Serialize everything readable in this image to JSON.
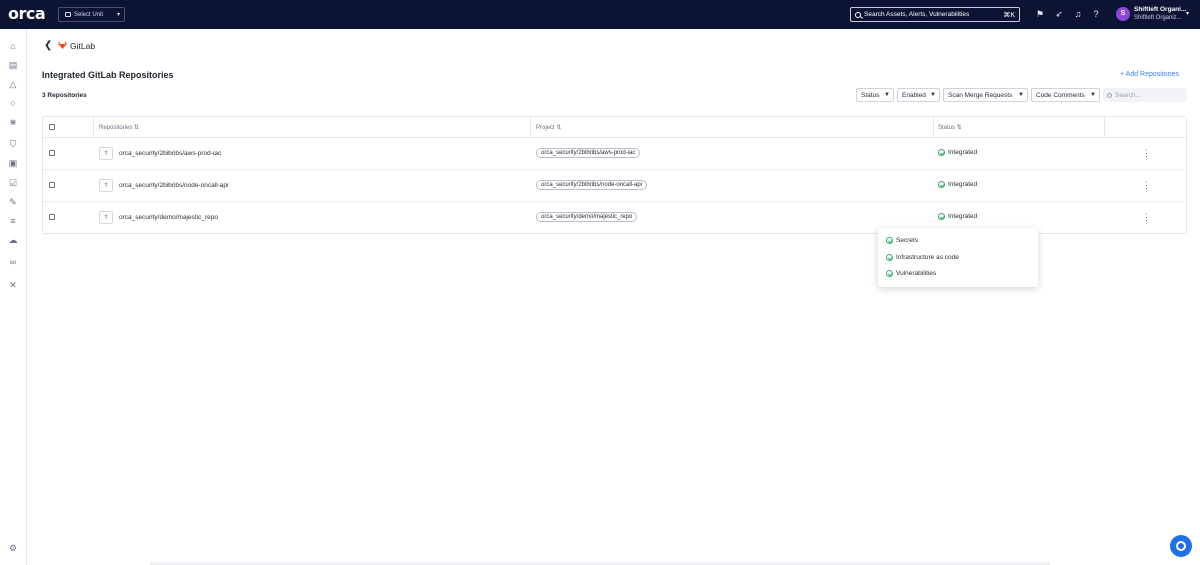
{
  "topbar": {
    "logo": "orca",
    "unit_select": "Select Unit",
    "search_placeholder": "Search Assets, Alerts, Vulnerabilities",
    "search_shortcut": "⌘K",
    "org_name": "Shiftleft Organi...",
    "org_sub": "Shiftleft Organiz...",
    "avatar_initial": "S"
  },
  "breadcrumb": {
    "title": "GitLab"
  },
  "section": {
    "title": "Integrated GitLab Repositories",
    "add_label": "+ Add Repositories",
    "count_label": "3 Repositories"
  },
  "filters": {
    "status": "Status",
    "enabled": "Enabled",
    "scan_merge": "Scan Merge Requests",
    "code_comments": "Code Comments",
    "search_placeholder": "Search..."
  },
  "table": {
    "headers": {
      "repositories": "Repositories ⇅",
      "project": "Project ⇅",
      "status": "Status ⇅"
    },
    "rows": [
      {
        "repo": "orca_security/2bibribs/aws-prod-iac",
        "project": "orca_security/2bibribs/aws-prod-iac",
        "status": "Integrated"
      },
      {
        "repo": "orca_security/2bibribs/node-oncall-api",
        "project": "orca_security/2bibribs/node-oncall-api",
        "status": "Integrated"
      },
      {
        "repo": "orca_security/demo/majestic_repo",
        "project": "orca_security/demo/majestic_repo",
        "status": "Integrated"
      }
    ]
  },
  "popover": {
    "items": [
      "Secrets",
      "Infrastructure as code",
      "Vulnerabilities"
    ]
  },
  "colors": {
    "topbar_bg": "#0d1333",
    "accent": "#3b82f6",
    "success": "#2fb06b",
    "avatar": "#8e46d9"
  }
}
